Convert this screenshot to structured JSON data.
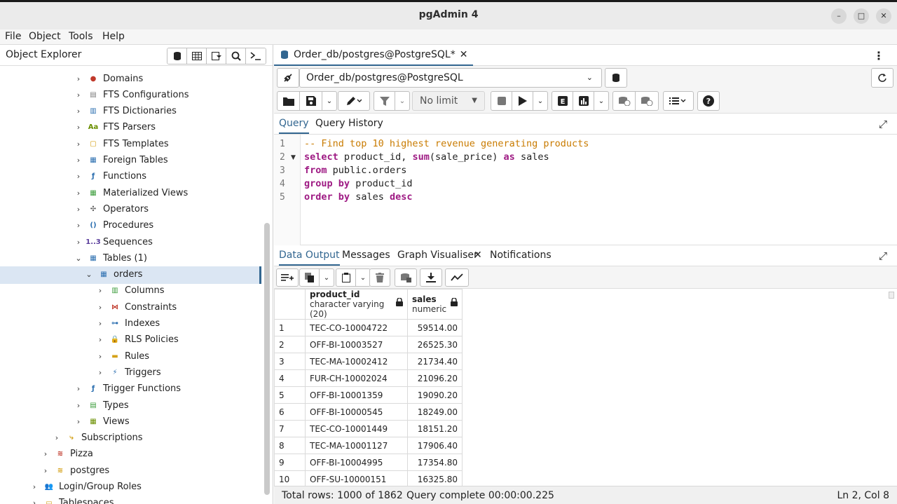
{
  "window": {
    "title": "pgAdmin 4"
  },
  "menu": [
    "File",
    "Object",
    "Tools",
    "Help"
  ],
  "object_explorer": {
    "title": "Object Explorer",
    "items": [
      {
        "label": "Domains",
        "icon": "domain-icon"
      },
      {
        "label": "FTS Configurations",
        "icon": "fts-configuration-icon"
      },
      {
        "label": "FTS Dictionaries",
        "icon": "fts-dictionary-icon"
      },
      {
        "label": "FTS Parsers",
        "icon": "fts-parser-icon"
      },
      {
        "label": "FTS Templates",
        "icon": "fts-template-icon"
      },
      {
        "label": "Foreign Tables",
        "icon": "foreign-table-icon"
      },
      {
        "label": "Functions",
        "icon": "function-icon"
      },
      {
        "label": "Materialized Views",
        "icon": "materialized-view-icon"
      },
      {
        "label": "Operators",
        "icon": "operator-icon"
      },
      {
        "label": "Procedures",
        "icon": "procedure-icon"
      },
      {
        "label": "Sequences",
        "icon": "sequence-icon"
      },
      {
        "label": "Tables (1)",
        "icon": "tables-icon"
      },
      {
        "label": "orders",
        "icon": "table-icon"
      },
      {
        "label": "Columns",
        "icon": "columns-icon"
      },
      {
        "label": "Constraints",
        "icon": "constraints-icon"
      },
      {
        "label": "Indexes",
        "icon": "indexes-icon"
      },
      {
        "label": "RLS Policies",
        "icon": "rls-policy-icon"
      },
      {
        "label": "Rules",
        "icon": "rules-icon"
      },
      {
        "label": "Triggers",
        "icon": "triggers-icon"
      },
      {
        "label": "Trigger Functions",
        "icon": "trigger-function-icon"
      },
      {
        "label": "Types",
        "icon": "type-icon"
      },
      {
        "label": "Views",
        "icon": "view-icon"
      },
      {
        "label": "Subscriptions",
        "icon": "subscription-icon"
      },
      {
        "label": "Pizza",
        "icon": "database-icon"
      },
      {
        "label": "postgres",
        "icon": "database-icon"
      },
      {
        "label": "Login/Group Roles",
        "icon": "role-icon"
      },
      {
        "label": "Tablespaces",
        "icon": "tablespace-icon"
      }
    ],
    "glyphs": {
      "fts_parsers": "Aa",
      "sequences": "1..3"
    }
  },
  "query_tab": {
    "title": "Order_db/postgres@PostgreSQL*"
  },
  "connection": {
    "value": "Order_db/postgres@PostgreSQL"
  },
  "toolbar": {
    "limit": "No limit"
  },
  "editor_tabs": [
    "Query",
    "Query History"
  ],
  "editor": {
    "line_numbers": [
      "1",
      "2",
      "3",
      "4",
      "5"
    ],
    "lines": [
      "-- Find top 10 highest revenue generating products",
      "select product_id, sum(sale_price) as sales",
      "from public.orders",
      "group by product_id",
      "order by sales desc"
    ]
  },
  "output_tabs": [
    "Data Output",
    "Messages",
    "Graph Visualiser",
    "Notifications"
  ],
  "result": {
    "columns": [
      {
        "name": "product_id",
        "type": "character varying (20)"
      },
      {
        "name": "sales",
        "type": "numeric"
      }
    ],
    "rows": [
      [
        "1",
        "TEC-CO-10004722",
        "59514.00"
      ],
      [
        "2",
        "OFF-BI-10003527",
        "26525.30"
      ],
      [
        "3",
        "TEC-MA-10002412",
        "21734.40"
      ],
      [
        "4",
        "FUR-CH-10002024",
        "21096.20"
      ],
      [
        "5",
        "OFF-BI-10001359",
        "19090.20"
      ],
      [
        "6",
        "OFF-BI-10000545",
        "18249.00"
      ],
      [
        "7",
        "TEC-CO-10001449",
        "18151.20"
      ],
      [
        "8",
        "TEC-MA-10001127",
        "17906.40"
      ],
      [
        "9",
        "OFF-BI-10004995",
        "17354.80"
      ],
      [
        "10",
        "OFF-SU-10000151",
        "16325.80"
      ]
    ]
  },
  "status": {
    "rows": "Total rows: 1000 of 1862",
    "query": "Query complete 00:00:00.225",
    "position": "Ln 2, Col 8"
  },
  "colors": {
    "accent": "#326690",
    "keyword": "#9e1a83",
    "comment": "#c97b00",
    "selection": "#dbe6f3"
  }
}
